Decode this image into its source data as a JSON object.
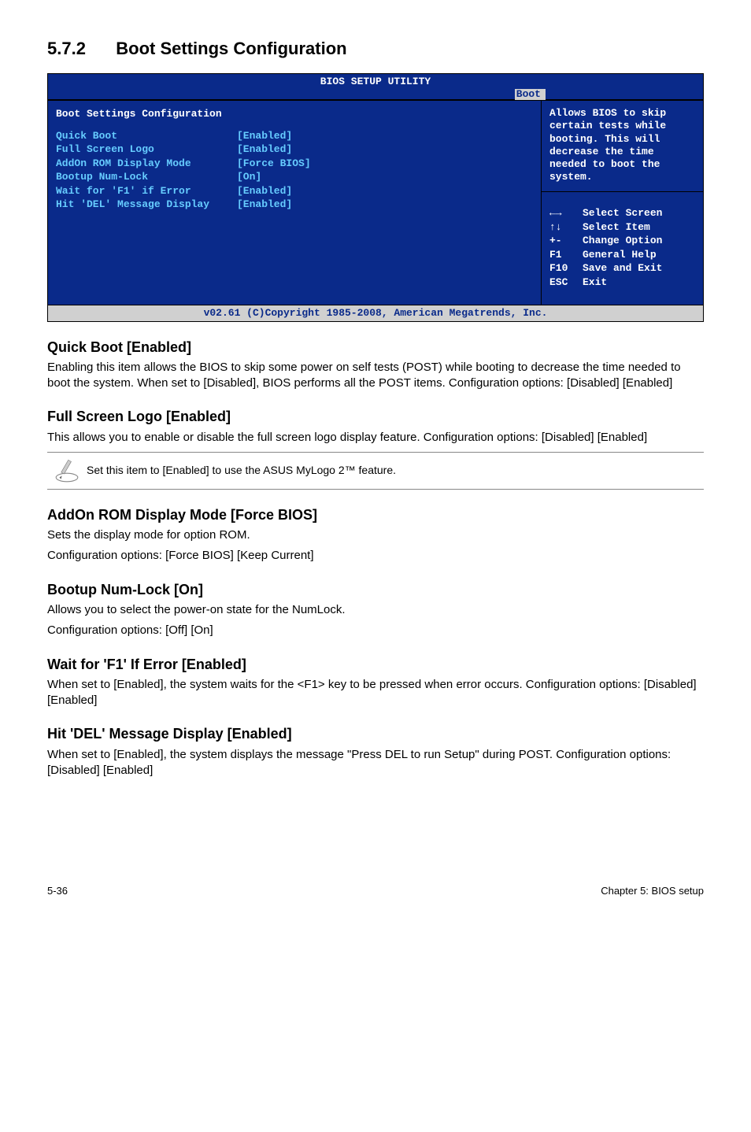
{
  "heading": {
    "number": "5.7.2",
    "title": "Boot Settings Configuration"
  },
  "bios": {
    "title": "BIOS SETUP UTILITY",
    "tab": "Boot",
    "config_title": "Boot Settings Configuration",
    "rows": [
      {
        "label": "Quick Boot",
        "value": "[Enabled]"
      },
      {
        "label": "Full Screen Logo",
        "value": "[Enabled]"
      },
      {
        "label": "AddOn ROM Display Mode",
        "value": "[Force BIOS]"
      },
      {
        "label": "Bootup Num-Lock",
        "value": "[On]"
      },
      {
        "label": "Wait for 'F1' if Error",
        "value": "[Enabled]"
      },
      {
        "label": "Hit 'DEL' Message Display",
        "value": "[Enabled]"
      }
    ],
    "help": "Allows BIOS to skip certain tests while booting. This will decrease the time needed to boot the system.",
    "nav": [
      {
        "key_glyph": "arrow-lr",
        "key": "",
        "label": "Select Screen"
      },
      {
        "key_glyph": "arrow-ud",
        "key": "",
        "label": "Select Item"
      },
      {
        "key_glyph": "",
        "key": "+-",
        "label": "Change Option"
      },
      {
        "key_glyph": "",
        "key": "F1",
        "label": "General Help"
      },
      {
        "key_glyph": "",
        "key": "F10",
        "label": "Save and Exit"
      },
      {
        "key_glyph": "",
        "key": "ESC",
        "label": "Exit"
      }
    ],
    "footer": "v02.61 (C)Copyright 1985-2008, American Megatrends, Inc."
  },
  "sections": [
    {
      "heading": "Quick Boot [Enabled]",
      "paragraphs": [
        "Enabling this item allows the BIOS to skip some power on self tests (POST) while booting to decrease the time needed to boot the system. When set to [Disabled], BIOS performs all the POST items. Configuration options: [Disabled] [Enabled]"
      ]
    },
    {
      "heading": "Full Screen Logo [Enabled]",
      "paragraphs": [
        "This allows you to enable or disable the full screen logo display feature. Configuration options: [Disabled] [Enabled]"
      ],
      "note": "Set this item to [Enabled] to use the ASUS MyLogo 2™ feature."
    },
    {
      "heading": "AddOn ROM Display Mode [Force BIOS]",
      "paragraphs": [
        "Sets the display mode for option ROM.",
        "Configuration options: [Force BIOS] [Keep Current]"
      ]
    },
    {
      "heading": "Bootup Num-Lock [On]",
      "paragraphs": [
        "Allows you to select the power-on state for the NumLock.",
        "Configuration options: [Off] [On]"
      ]
    },
    {
      "heading": "Wait for 'F1' If Error [Enabled]",
      "paragraphs": [
        "When set to [Enabled], the system waits for the <F1> key to be pressed when error occurs. Configuration options: [Disabled] [Enabled]"
      ]
    },
    {
      "heading": "Hit 'DEL' Message Display [Enabled]",
      "paragraphs": [
        "When set to [Enabled], the system displays the message \"Press DEL to run Setup\" during POST. Configuration options: [Disabled] [Enabled]"
      ]
    }
  ],
  "footer": {
    "left": "5-36",
    "right": "Chapter 5: BIOS setup"
  }
}
